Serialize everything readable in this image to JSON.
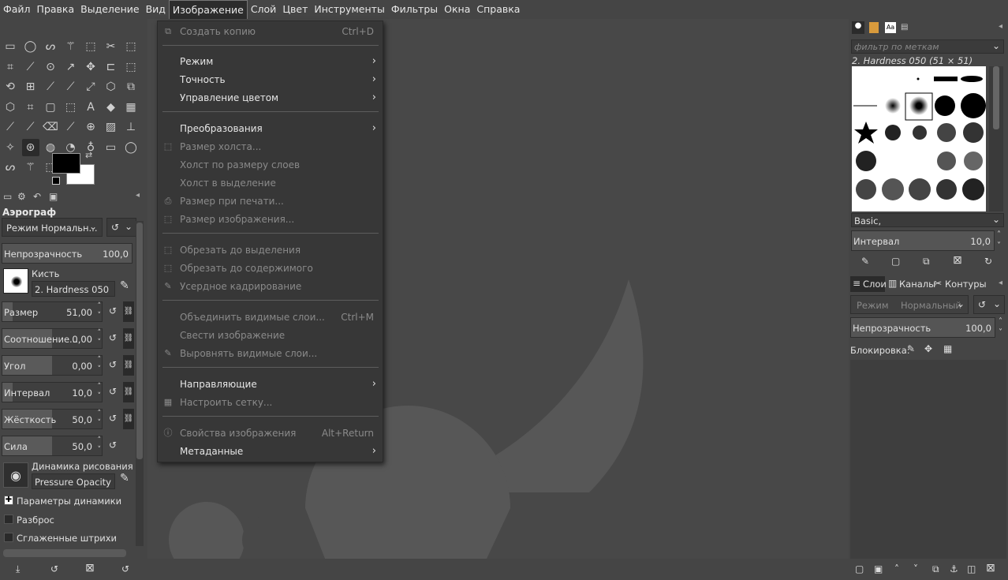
{
  "menubar": {
    "items": [
      "Файл",
      "Правка",
      "Выделение",
      "Вид",
      "Изображение",
      "Слой",
      "Цвет",
      "Инструменты",
      "Фильтры",
      "Окна",
      "Справка"
    ],
    "active_index": 4
  },
  "image_menu": {
    "items": [
      {
        "label": "Создать копию",
        "shortcut": "Ctrl+D",
        "enabled": false,
        "icon": "duplicate-icon"
      },
      {
        "label": "Режим",
        "submenu": true,
        "enabled": true
      },
      {
        "label": "Точность",
        "submenu": true,
        "enabled": true
      },
      {
        "label": "Управление цветом",
        "submenu": true,
        "enabled": true
      },
      {
        "label": "Преобразования",
        "submenu": true,
        "enabled": true
      },
      {
        "label": "Размер холста...",
        "enabled": false,
        "icon": "canvas-size-icon"
      },
      {
        "label": "Холст по размеру слоев",
        "enabled": false
      },
      {
        "label": "Холст в выделение",
        "enabled": false
      },
      {
        "label": "Размер при печати...",
        "enabled": false,
        "icon": "print-size-icon"
      },
      {
        "label": "Размер изображения...",
        "enabled": false,
        "icon": "scale-image-icon"
      },
      {
        "label": "Обрезать до выделения",
        "enabled": false,
        "icon": "crop-icon"
      },
      {
        "label": "Обрезать до содержимого",
        "enabled": false,
        "icon": "crop-icon"
      },
      {
        "label": "Усердное кадрирование",
        "enabled": false,
        "icon": "zealous-crop-icon"
      },
      {
        "label": "Объединить видимые слои...",
        "shortcut": "Ctrl+M",
        "enabled": false
      },
      {
        "label": "Свести изображение",
        "enabled": false
      },
      {
        "label": "Выровнять видимые слои...",
        "enabled": false,
        "icon": "align-icon"
      },
      {
        "label": "Направляющие",
        "submenu": true,
        "enabled": true
      },
      {
        "label": "Настроить сетку...",
        "enabled": false,
        "icon": "grid-icon"
      },
      {
        "label": "Свойства изображения",
        "shortcut": "Alt+Return",
        "enabled": false,
        "icon": "info-icon"
      },
      {
        "label": "Метаданные",
        "submenu": true,
        "enabled": true
      }
    ]
  },
  "tool_options": {
    "title": "Аэрограф",
    "mode": "Режим Нормальн...",
    "opacity_label": "Непрозрачность",
    "opacity_value": "100,0",
    "brush_label": "Кисть",
    "brush_name": "2. Hardness 050",
    "params": [
      {
        "label": "Размер",
        "value": "51,00",
        "fill": 0.1
      },
      {
        "label": "Соотношение...",
        "value": "0,00",
        "fill": 0.5
      },
      {
        "label": "Угол",
        "value": "0,00",
        "fill": 0.5
      },
      {
        "label": "Интервал",
        "value": "10,0",
        "fill": 0.1
      },
      {
        "label": "Жёсткость",
        "value": "50,0",
        "fill": 0.5
      },
      {
        "label": "Сила",
        "value": "50,0",
        "fill": 0.5
      }
    ],
    "dynamics_label": "Динамика рисования",
    "dynamics_name": "Pressure Opacity",
    "checkboxes": [
      "Параметры динамики",
      "Разброс",
      "Сглаженные штрихи"
    ]
  },
  "brushes": {
    "filter_placeholder": "фильтр по меткам",
    "selected": "2. Hardness 050 (51 × 51)",
    "preset": "Basic,",
    "spacing_label": "Интервал",
    "spacing_value": "10,0"
  },
  "layers": {
    "tabs": [
      "Слои",
      "Каналы",
      "Контуры"
    ],
    "mode_label": "Режим",
    "mode_value": "Нормальный",
    "opacity_label": "Непрозрачность",
    "opacity_value": "100,0",
    "lock_label": "Блокировка:"
  },
  "colors": {
    "fg": "#000000",
    "bg": "#ffffff",
    "accent": "#2c2c2c"
  }
}
